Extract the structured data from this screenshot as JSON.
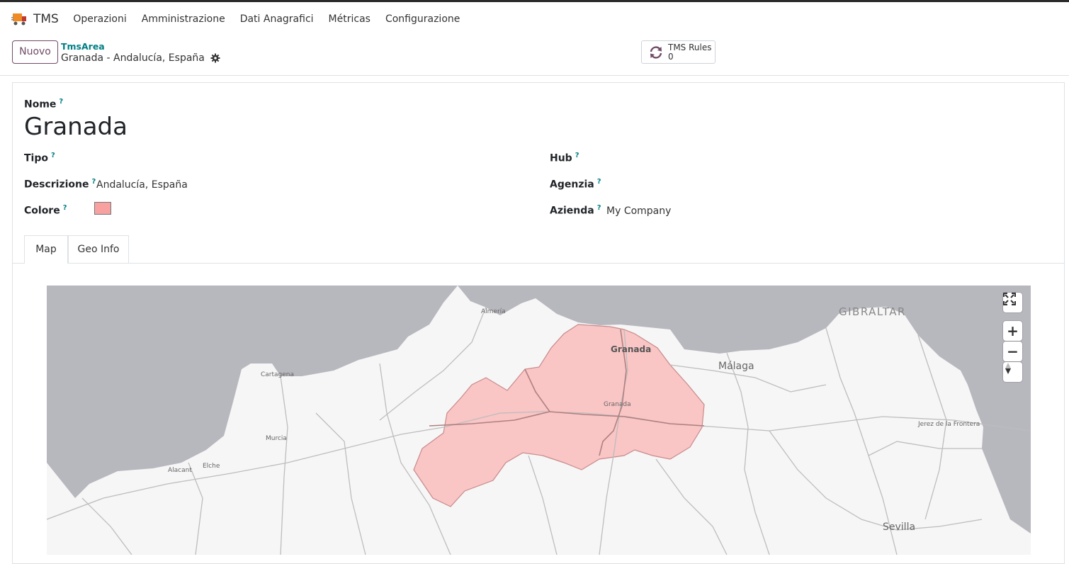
{
  "app": {
    "name": "TMS"
  },
  "menu": [
    "Operazioni",
    "Amministrazione",
    "Dati Anagrafici",
    "Métricas",
    "Configurazione"
  ],
  "control": {
    "new_label": "Nuovo",
    "breadcrumb_parent": "TmsArea",
    "breadcrumb_current": "Granada - Andalucía, España",
    "smart_button": {
      "label": "TMS Rules",
      "count": "0"
    }
  },
  "form": {
    "nome_label": "Nome",
    "nome_value": "Granada",
    "tipo_label": "Tipo",
    "descrizione_label": "Descrizione",
    "descrizione_value": "Andalucía, España",
    "colore_label": "Colore",
    "colore_value": "#f7a1a1",
    "hub_label": "Hub",
    "agenzia_label": "Agenzia",
    "azienda_label": "Azienda",
    "azienda_value": "My Company",
    "help_mark": "?"
  },
  "tabs": [
    "Map",
    "Geo Info"
  ],
  "map": {
    "labels": {
      "gibraltar": "GIBRALTAR",
      "malaga": "Málaga",
      "granada_main": "Granada",
      "granada_small": "Granada",
      "almeria": "Almería",
      "cartagena": "Cartagena",
      "murcia": "Murcia",
      "alicante": "Alacant",
      "elche": "Elche",
      "jerez": "Jerez de la Frontera",
      "sevilla": "Sevilla"
    },
    "controls": {
      "zoom_in": "+",
      "zoom_out": "−"
    },
    "area_color": "#f9c5c5",
    "area_border": "#c98a8a"
  }
}
